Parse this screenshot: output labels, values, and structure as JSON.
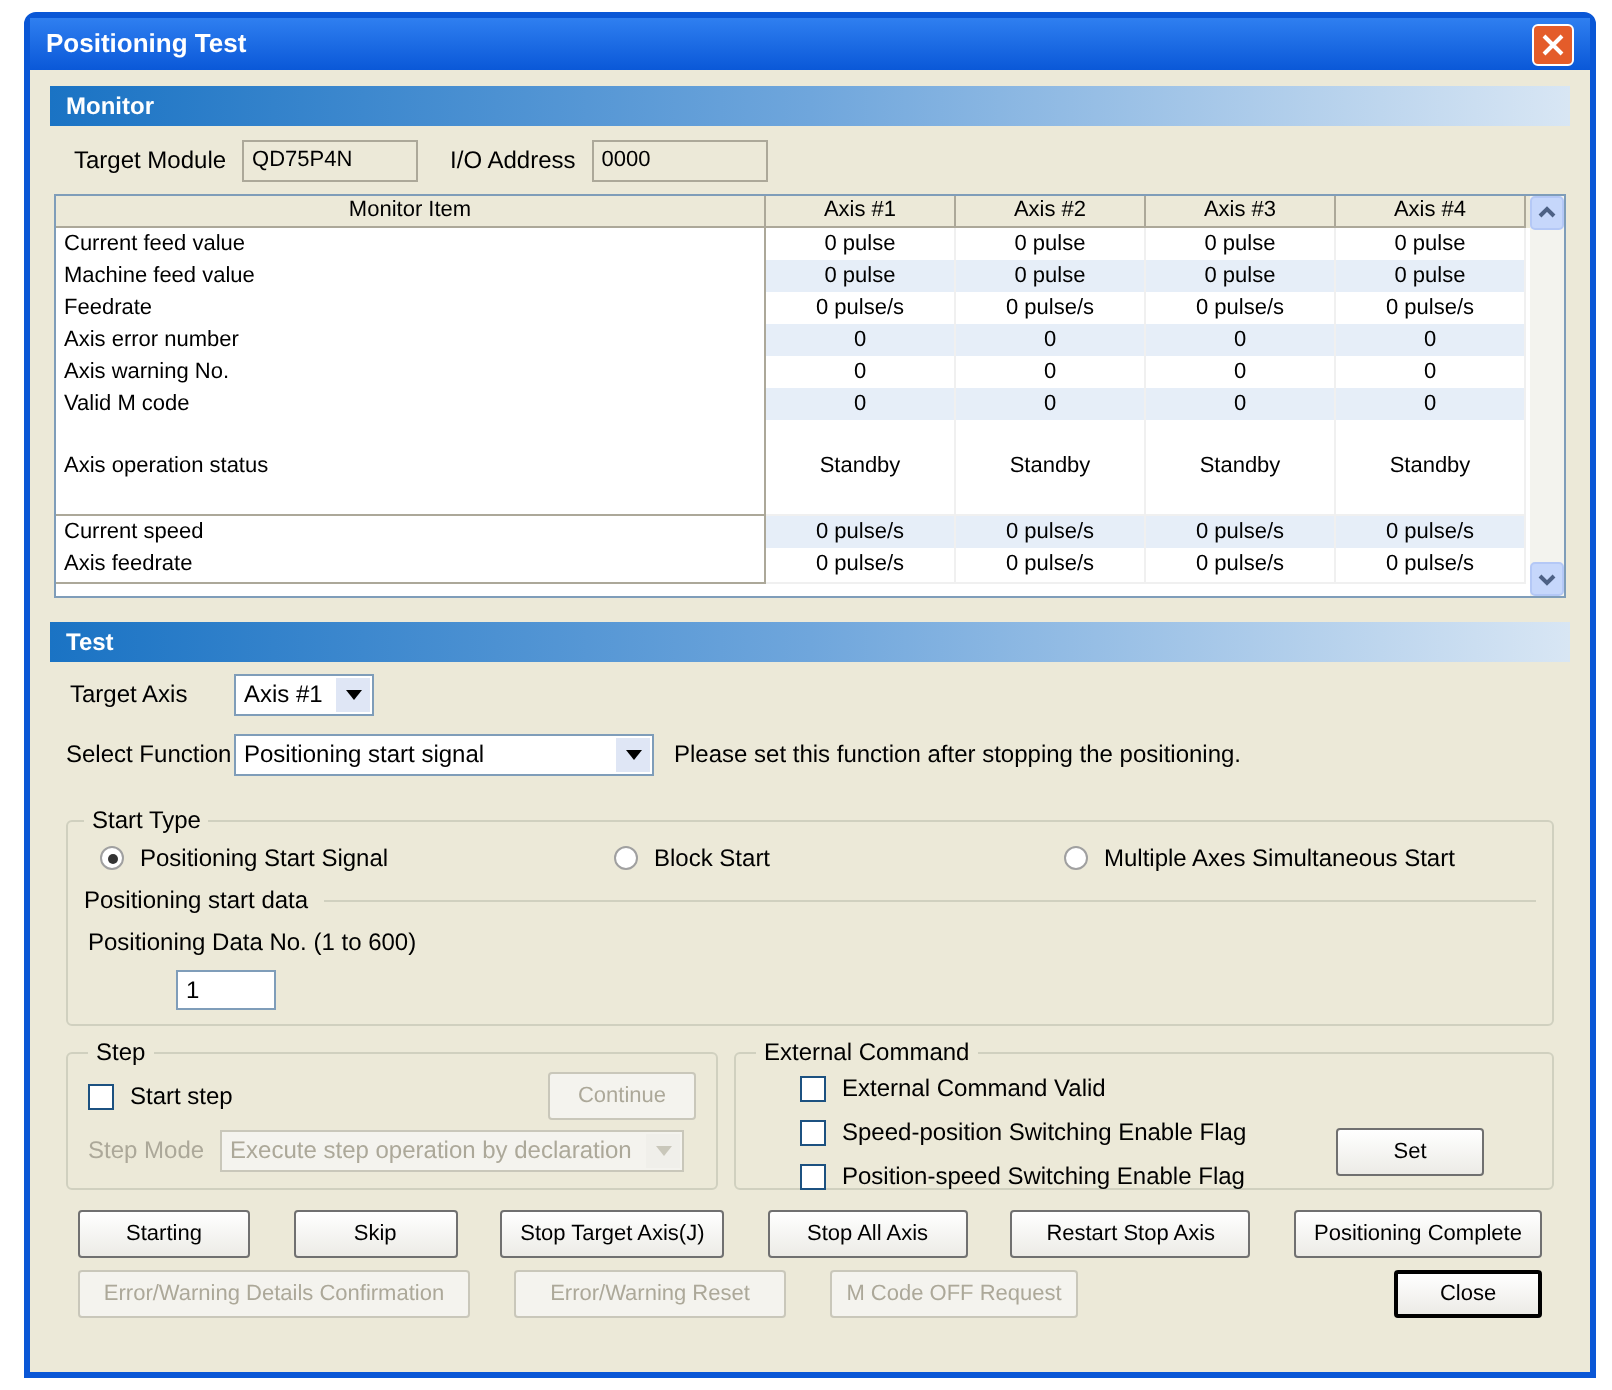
{
  "window": {
    "title": "Positioning Test"
  },
  "monitor": {
    "title": "Monitor",
    "target_module": {
      "label": "Target Module",
      "value": "QD75P4N"
    },
    "io_address": {
      "label": "I/O Address",
      "value": "0000"
    },
    "table": {
      "columns": [
        "Monitor Item",
        "Axis #1",
        "Axis #2",
        "Axis #3",
        "Axis #4"
      ],
      "rows": [
        {
          "kind": "normal",
          "item": "Current feed value",
          "values": [
            "0 pulse",
            "0 pulse",
            "0 pulse",
            "0 pulse"
          ]
        },
        {
          "kind": "normal",
          "item": "Machine feed value",
          "values": [
            "0 pulse",
            "0 pulse",
            "0 pulse",
            "0 pulse"
          ]
        },
        {
          "kind": "normal",
          "item": "Feedrate",
          "values": [
            "0 pulse/s",
            "0 pulse/s",
            "0 pulse/s",
            "0 pulse/s"
          ]
        },
        {
          "kind": "normal",
          "item": "Axis error number",
          "values": [
            "0",
            "0",
            "0",
            "0"
          ]
        },
        {
          "kind": "normal",
          "item": "Axis warning No.",
          "values": [
            "0",
            "0",
            "0",
            "0"
          ]
        },
        {
          "kind": "normal",
          "item": "Valid M code",
          "values": [
            "0",
            "0",
            "0",
            "0"
          ]
        },
        {
          "kind": "tall",
          "item": "Axis operation status",
          "values": [
            "Standby",
            "Standby",
            "Standby",
            "Standby"
          ]
        },
        {
          "kind": "normal",
          "item": "Current speed",
          "values": [
            "0 pulse/s",
            "0 pulse/s",
            "0 pulse/s",
            "0 pulse/s"
          ]
        },
        {
          "kind": "normal",
          "item": "Axis feedrate",
          "values": [
            "0 pulse/s",
            "0 pulse/s",
            "0 pulse/s",
            "0 pulse/s"
          ]
        }
      ]
    }
  },
  "test": {
    "title": "Test",
    "target_axis": {
      "label": "Target Axis",
      "value": "Axis #1"
    },
    "select_function": {
      "label": "Select Function",
      "value": "Positioning start signal",
      "note": "Please set this function after stopping the positioning."
    },
    "start_type": {
      "title": "Start Type",
      "options": [
        {
          "label": "Positioning Start Signal",
          "selected": true
        },
        {
          "label": "Block Start",
          "selected": false
        },
        {
          "label": "Multiple Axes Simultaneous Start",
          "selected": false
        }
      ],
      "data_title": "Positioning start data",
      "data_label": "Positioning Data No. (1 to 600)",
      "data_value": "1"
    },
    "step": {
      "title": "Step",
      "start_step": {
        "label": "Start step",
        "checked": false
      },
      "continue": {
        "label": "Continue",
        "disabled": true
      },
      "mode": {
        "label": "Step Mode",
        "value": "Execute step operation by declaration",
        "disabled": true
      }
    },
    "external": {
      "title": "External Command",
      "flags": [
        {
          "label": "External Command Valid",
          "checked": false
        },
        {
          "label": "Speed-position Switching Enable Flag",
          "checked": false
        },
        {
          "label": "Position-speed Switching Enable Flag",
          "checked": false
        }
      ],
      "set": {
        "label": "Set",
        "disabled": false
      }
    },
    "buttons_row1": [
      {
        "label": "Starting",
        "disabled": false
      },
      {
        "label": "Skip",
        "disabled": false
      },
      {
        "label": "Stop Target Axis(J)",
        "disabled": false
      },
      {
        "label": "Stop All Axis",
        "disabled": false
      },
      {
        "label": "Restart Stop Axis",
        "disabled": false
      },
      {
        "label": "Positioning Complete",
        "disabled": false
      }
    ],
    "buttons_row2": [
      {
        "label": "Error/Warning Details Confirmation",
        "disabled": true
      },
      {
        "label": "Error/Warning Reset",
        "disabled": true
      },
      {
        "label": "M Code OFF Request",
        "disabled": true
      }
    ],
    "close": {
      "label": "Close",
      "disabled": false
    }
  }
}
